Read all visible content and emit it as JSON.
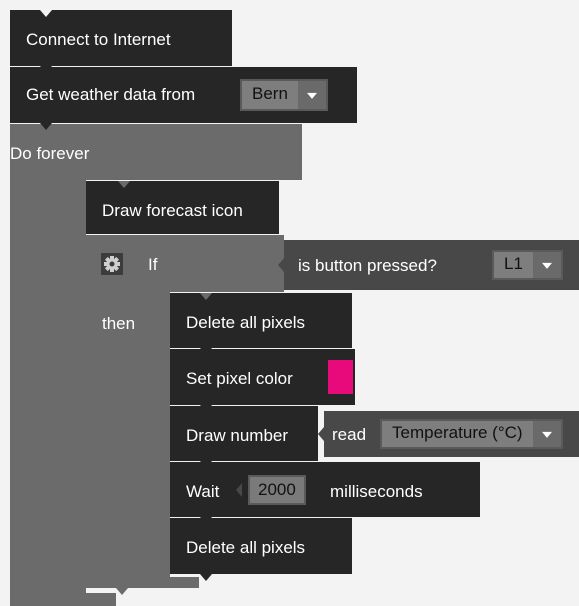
{
  "blocks": {
    "connect": "Connect to Internet",
    "weather": {
      "label": "Get weather data from",
      "city": "Bern"
    },
    "forever": "Do forever",
    "draw_icon": "Draw forecast icon",
    "if_block": {
      "if_label": "If",
      "then_label": "then",
      "condition": "is button pressed?",
      "button": "L1"
    },
    "delete1": "Delete all pixels",
    "set_color": {
      "label": "Set pixel color",
      "color": "#e8097a"
    },
    "draw_number": {
      "label": "Draw number",
      "read_label": "read",
      "sensor": "Temperature (°C)"
    },
    "wait": {
      "label": "Wait",
      "value": "2000",
      "unit": "milliseconds"
    },
    "delete2": "Delete all pixels"
  },
  "icons": {
    "settings": "gear-icon",
    "dropdown": "dropdown-arrow-icon"
  }
}
